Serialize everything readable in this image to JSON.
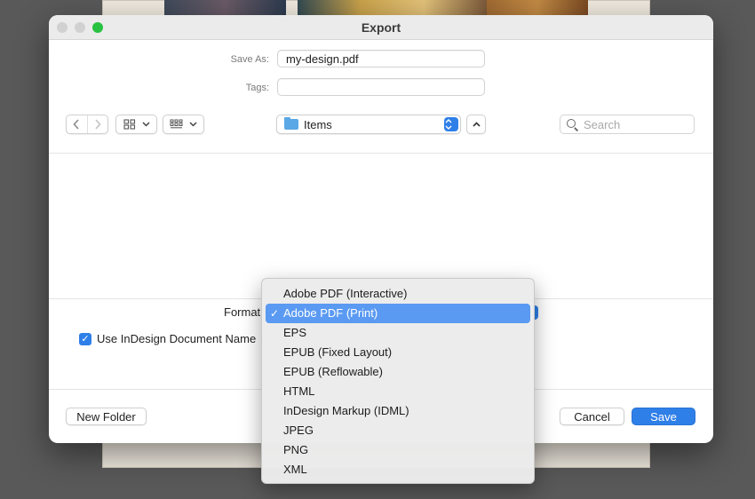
{
  "window": {
    "title": "Export"
  },
  "form": {
    "save_as_label": "Save As:",
    "save_as_value": "my-design.pdf",
    "tags_label": "Tags:",
    "tags_value": ""
  },
  "toolbar": {
    "back_icon": "chevron-left-icon",
    "forward_icon": "chevron-right-icon",
    "location_label": "Items",
    "search_placeholder": "Search"
  },
  "options": {
    "format_label": "Format",
    "use_doc_name_label": "Use InDesign Document Name",
    "use_doc_name_checked": true
  },
  "format_menu": {
    "items": [
      {
        "label": "Adobe PDF (Interactive)",
        "selected": false
      },
      {
        "label": "Adobe PDF (Print)",
        "selected": true
      },
      {
        "label": "EPS",
        "selected": false
      },
      {
        "label": "EPUB (Fixed Layout)",
        "selected": false
      },
      {
        "label": "EPUB (Reflowable)",
        "selected": false
      },
      {
        "label": "HTML",
        "selected": false
      },
      {
        "label": "InDesign Markup (IDML)",
        "selected": false
      },
      {
        "label": "JPEG",
        "selected": false
      },
      {
        "label": "PNG",
        "selected": false
      },
      {
        "label": "XML",
        "selected": false
      }
    ],
    "check_glyph": "✓"
  },
  "buttons": {
    "new_folder": "New Folder",
    "cancel": "Cancel",
    "save": "Save"
  },
  "colors": {
    "accent": "#2f7fe8",
    "menu_highlight": "#5a9af2",
    "zoom_button": "#29c141"
  }
}
